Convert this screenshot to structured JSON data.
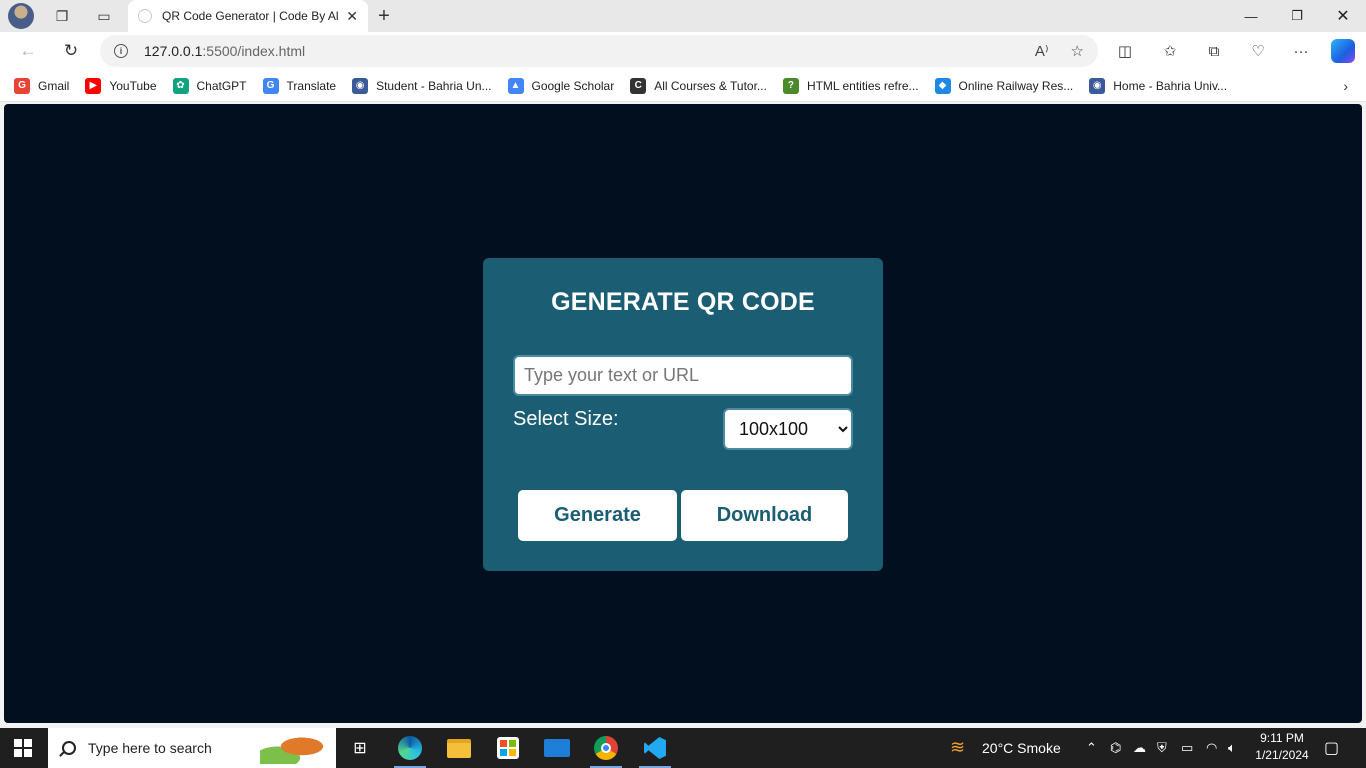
{
  "browser": {
    "tab_title": "QR Code Generator | Code By Al",
    "url_host": "127.0.0.1",
    "url_rest": ":5500/index.html",
    "bookmarks": [
      {
        "label": "Gmail",
        "color": "#ea4335",
        "glyph": "G"
      },
      {
        "label": "YouTube",
        "color": "#ff0000",
        "glyph": "▶"
      },
      {
        "label": "ChatGPT",
        "color": "#10a37f",
        "glyph": "✿"
      },
      {
        "label": "Translate",
        "color": "#4285f4",
        "glyph": "G"
      },
      {
        "label": "Student - Bahria Un...",
        "color": "#3a5a9a",
        "glyph": "◉"
      },
      {
        "label": "Google Scholar",
        "color": "#4285f4",
        "glyph": "▲"
      },
      {
        "label": "All Courses & Tutor...",
        "color": "#333333",
        "glyph": "C"
      },
      {
        "label": "HTML entities refre...",
        "color": "#4a8a2a",
        "glyph": "?"
      },
      {
        "label": "Online Railway Res...",
        "color": "#1e88e5",
        "glyph": "◆"
      },
      {
        "label": "Home - Bahria Univ...",
        "color": "#3a5a9a",
        "glyph": "◉"
      }
    ]
  },
  "app": {
    "heading": "GENERATE QR CODE",
    "input_placeholder": "Type your text or URL",
    "size_label": "Select Size:",
    "size_selected": "100x100",
    "generate_label": "Generate",
    "download_label": "Download",
    "accent_color": "#1b5d73",
    "background_color": "#010f1e"
  },
  "taskbar": {
    "search_placeholder": "Type here to search",
    "weather": "20°C  Smoke",
    "time": "9:11 PM",
    "date": "1/21/2024"
  }
}
